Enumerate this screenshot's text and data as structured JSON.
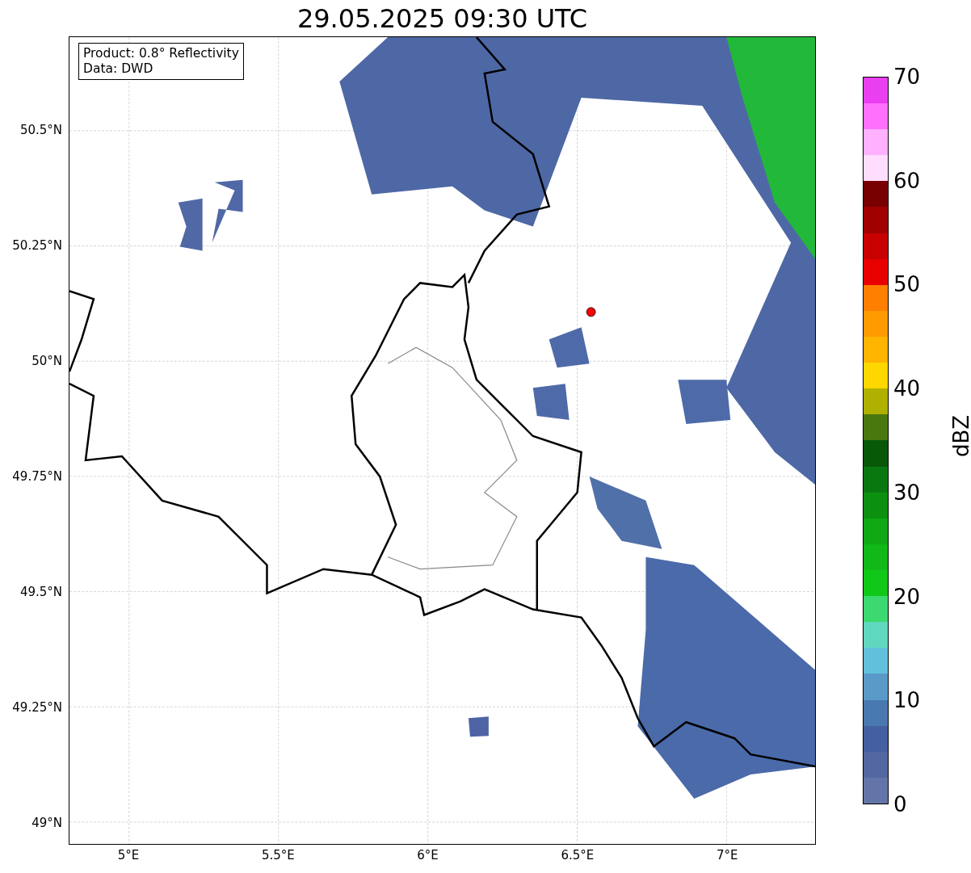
{
  "title": "29.05.2025 09:30 UTC",
  "map": {
    "info": [
      "Product: 0.8° Reflectivity",
      "Data: DWD"
    ],
    "y_ticks": [
      "50.5°N",
      "50.25°N",
      "50°N",
      "49.75°N",
      "49.5°N",
      "49.25°N",
      "49°N"
    ],
    "x_ticks": [
      "5°E",
      "5.5°E",
      "6°E",
      "6.5°E",
      "7°E"
    ]
  },
  "colorbar": {
    "label": "dBZ",
    "ticks": [
      "70",
      "60",
      "50",
      "40",
      "30",
      "20",
      "10",
      "0"
    ],
    "bins": [
      {
        "color": "#6374a8"
      },
      {
        "color": "#5368a0"
      },
      {
        "color": "#4560a0"
      },
      {
        "color": "#4a78b0"
      },
      {
        "color": "#5a9ac8"
      },
      {
        "color": "#62c0dc"
      },
      {
        "color": "#60d8c0"
      },
      {
        "color": "#3cd870"
      },
      {
        "color": "#10c818"
      },
      {
        "color": "#10b818"
      },
      {
        "color": "#10a814"
      },
      {
        "color": "#0c9010"
      },
      {
        "color": "#0a7810"
      },
      {
        "color": "#085808"
      },
      {
        "color": "#4a7810"
      },
      {
        "color": "#b0b000"
      },
      {
        "color": "#ffd700"
      },
      {
        "color": "#ffb400"
      },
      {
        "color": "#ff9b00"
      },
      {
        "color": "#ff7f00"
      },
      {
        "color": "#e80000"
      },
      {
        "color": "#c80000"
      },
      {
        "color": "#a00000"
      },
      {
        "color": "#780000"
      },
      {
        "color": "#ffddff"
      },
      {
        "color": "#ffb0ff"
      },
      {
        "color": "#ff70ff"
      },
      {
        "color": "#ea3ff0"
      }
    ]
  }
}
